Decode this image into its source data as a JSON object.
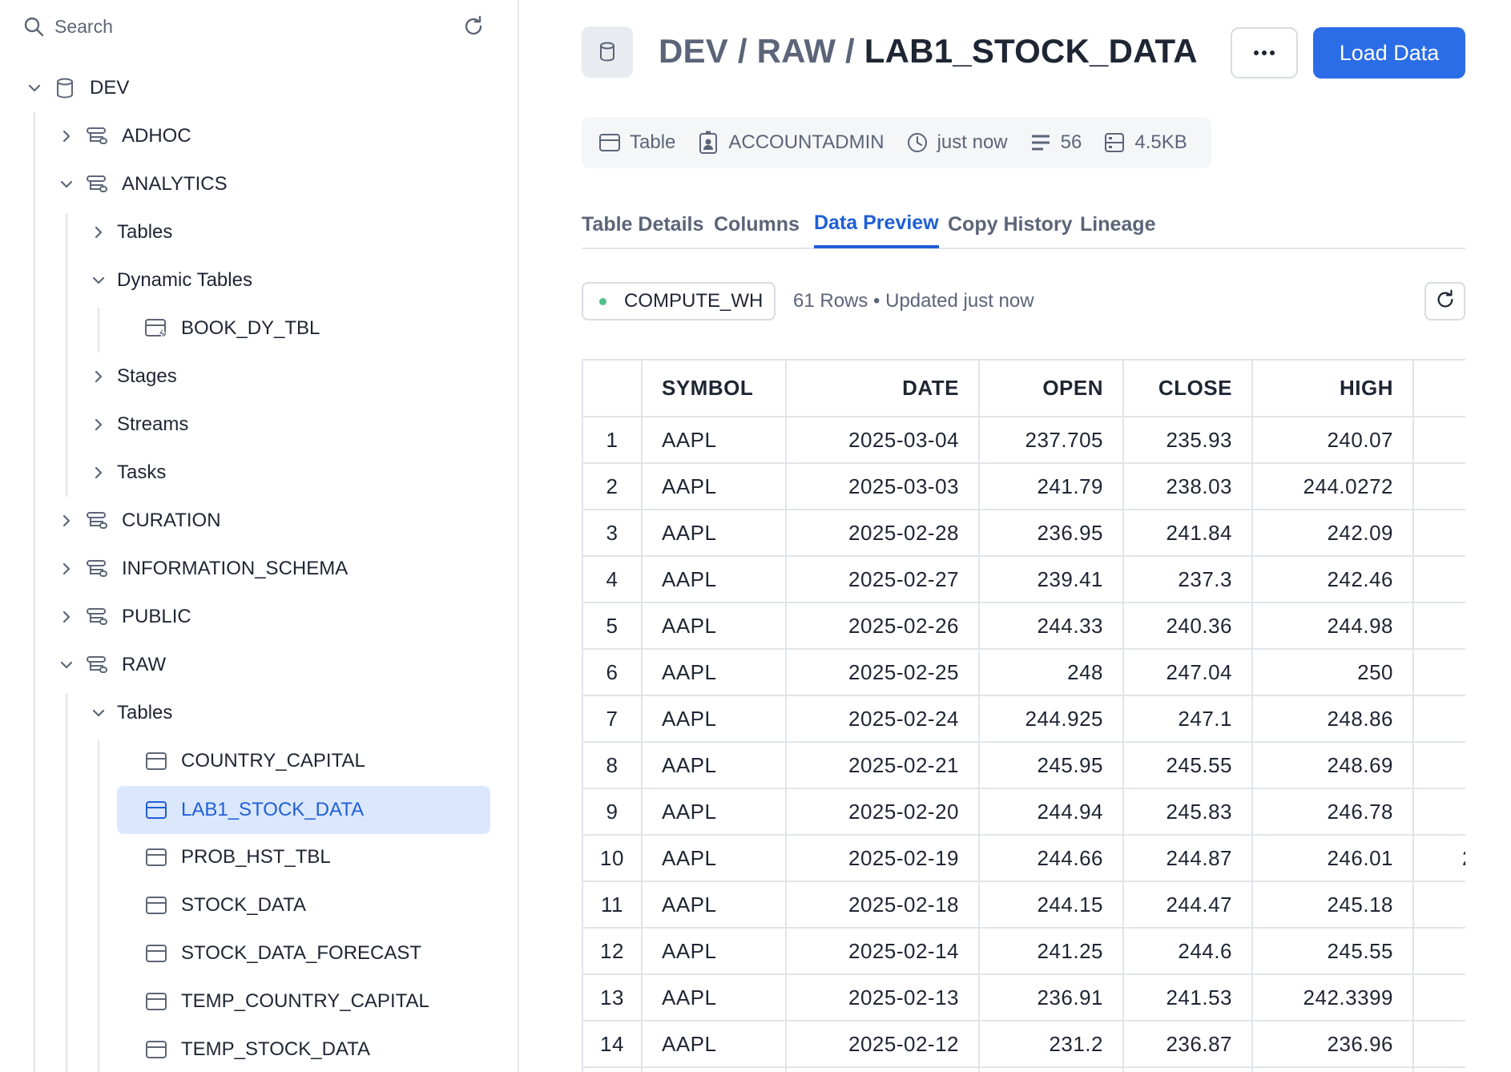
{
  "sidebar": {
    "search_placeholder": "Search",
    "tree": [
      {
        "label": "DEV",
        "expanded": true,
        "icon": "database-icon"
      },
      {
        "label": "ADHOC",
        "expanded": false,
        "icon": "schema-icon"
      },
      {
        "label": "ANALYTICS",
        "expanded": true,
        "icon": "schema-icon"
      },
      {
        "label": "Tables",
        "expanded": false
      },
      {
        "label": "Dynamic Tables",
        "expanded": true
      },
      {
        "label": "BOOK_DY_TBL",
        "icon": "dynamic-table-icon"
      },
      {
        "label": "Stages",
        "expanded": false
      },
      {
        "label": "Streams",
        "expanded": false
      },
      {
        "label": "Tasks",
        "expanded": false
      },
      {
        "label": "CURATION",
        "expanded": false,
        "icon": "schema-icon"
      },
      {
        "label": "INFORMATION_SCHEMA",
        "expanded": false,
        "icon": "schema-icon"
      },
      {
        "label": "PUBLIC",
        "expanded": false,
        "icon": "schema-icon"
      },
      {
        "label": "RAW",
        "expanded": true,
        "icon": "schema-icon"
      },
      {
        "label": "Tables",
        "expanded": true
      },
      {
        "label": "COUNTRY_CAPITAL",
        "icon": "table-icon"
      },
      {
        "label": "LAB1_STOCK_DATA",
        "icon": "table-icon",
        "selected": true
      },
      {
        "label": "PROB_HST_TBL",
        "icon": "table-icon"
      },
      {
        "label": "STOCK_DATA",
        "icon": "table-icon"
      },
      {
        "label": "STOCK_DATA_FORECAST",
        "icon": "table-icon"
      },
      {
        "label": "TEMP_COUNTRY_CAPITAL",
        "icon": "table-icon"
      },
      {
        "label": "TEMP_STOCK_DATA",
        "icon": "table-icon"
      }
    ]
  },
  "header": {
    "crumb_db": "DEV",
    "sep1": " / ",
    "crumb_schema": "RAW",
    "sep2": " / ",
    "current": "LAB1_STOCK_DATA",
    "load_label": "Load Data"
  },
  "meta": {
    "type": "Table",
    "owner": "ACCOUNTADMIN",
    "updated": "just now",
    "columns": "56",
    "size": "4.5KB"
  },
  "tabs": [
    "Table Details",
    "Columns",
    "Data Preview",
    "Copy History",
    "Lineage"
  ],
  "active_tab": "Data Preview",
  "preview": {
    "warehouse": "COMPUTE_WH",
    "rows_info": "61 Rows • Updated just now",
    "columns": [
      "",
      "SYMBOL",
      "DATE",
      "OPEN",
      "CLOSE",
      "HIGH",
      ""
    ],
    "rows": [
      [
        "1",
        "AAPL",
        "2025-03-04",
        "237.705",
        "235.93",
        "240.07",
        ""
      ],
      [
        "2",
        "AAPL",
        "2025-03-03",
        "241.79",
        "238.03",
        "244.0272",
        ""
      ],
      [
        "3",
        "AAPL",
        "2025-02-28",
        "236.95",
        "241.84",
        "242.09",
        ""
      ],
      [
        "4",
        "AAPL",
        "2025-02-27",
        "239.41",
        "237.3",
        "242.46",
        ""
      ],
      [
        "5",
        "AAPL",
        "2025-02-26",
        "244.33",
        "240.36",
        "244.98",
        ""
      ],
      [
        "6",
        "AAPL",
        "2025-02-25",
        "248",
        "247.04",
        "250",
        ""
      ],
      [
        "7",
        "AAPL",
        "2025-02-24",
        "244.925",
        "247.1",
        "248.86",
        ""
      ],
      [
        "8",
        "AAPL",
        "2025-02-21",
        "245.95",
        "245.55",
        "248.69",
        ""
      ],
      [
        "9",
        "AAPL",
        "2025-02-20",
        "244.94",
        "245.83",
        "246.78",
        ""
      ],
      [
        "10",
        "AAPL",
        "2025-02-19",
        "244.66",
        "244.87",
        "246.01",
        "2"
      ],
      [
        "11",
        "AAPL",
        "2025-02-18",
        "244.15",
        "244.47",
        "245.18",
        ""
      ],
      [
        "12",
        "AAPL",
        "2025-02-14",
        "241.25",
        "244.6",
        "245.55",
        ""
      ],
      [
        "13",
        "AAPL",
        "2025-02-13",
        "236.91",
        "241.53",
        "242.3399",
        ""
      ],
      [
        "14",
        "AAPL",
        "2025-02-12",
        "231.2",
        "236.87",
        "236.96",
        ""
      ],
      [
        "",
        "",
        "",
        "",
        "",
        "",
        ""
      ]
    ]
  },
  "colors": {
    "accent": "#2b6de6",
    "selected_bg": "#dbe7fd",
    "selected_text": "#1f5fd6",
    "status_dot": "#4fbf8a",
    "border": "#e1e4ea"
  }
}
